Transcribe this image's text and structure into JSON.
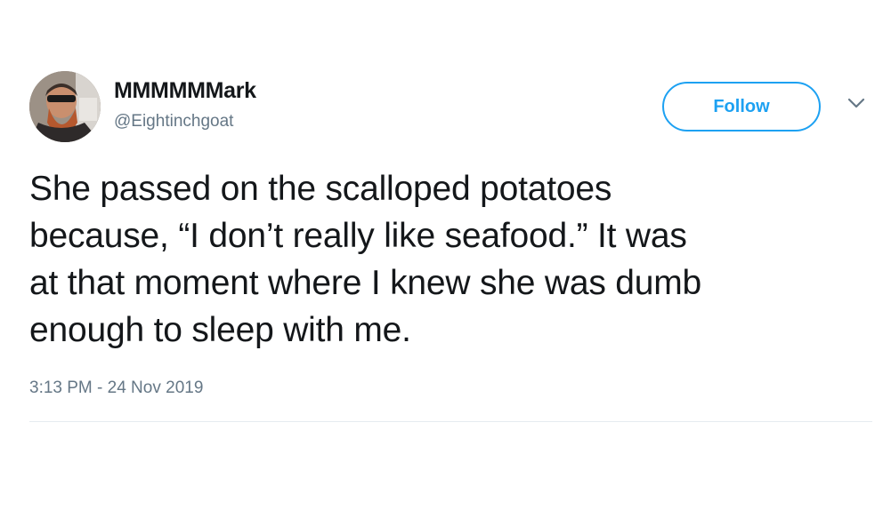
{
  "tweet": {
    "author": {
      "display_name": "MMMMMMark",
      "handle": "@Eightinchgoat",
      "avatar_icon": "profile-photo"
    },
    "follow_label": "Follow",
    "menu_icon": "chevron-down-icon",
    "text": "She passed on the scalloped potatoes\nbecause, “I don’t really like seafood.”  It was\nat that moment where I knew she was dumb\nenough to sleep with me.",
    "timestamp": "3:13 PM - 24 Nov 2019"
  },
  "colors": {
    "accent": "#1da1f2",
    "text_primary": "#14171a",
    "text_secondary": "#657786",
    "divider": "#e6ecf0"
  }
}
